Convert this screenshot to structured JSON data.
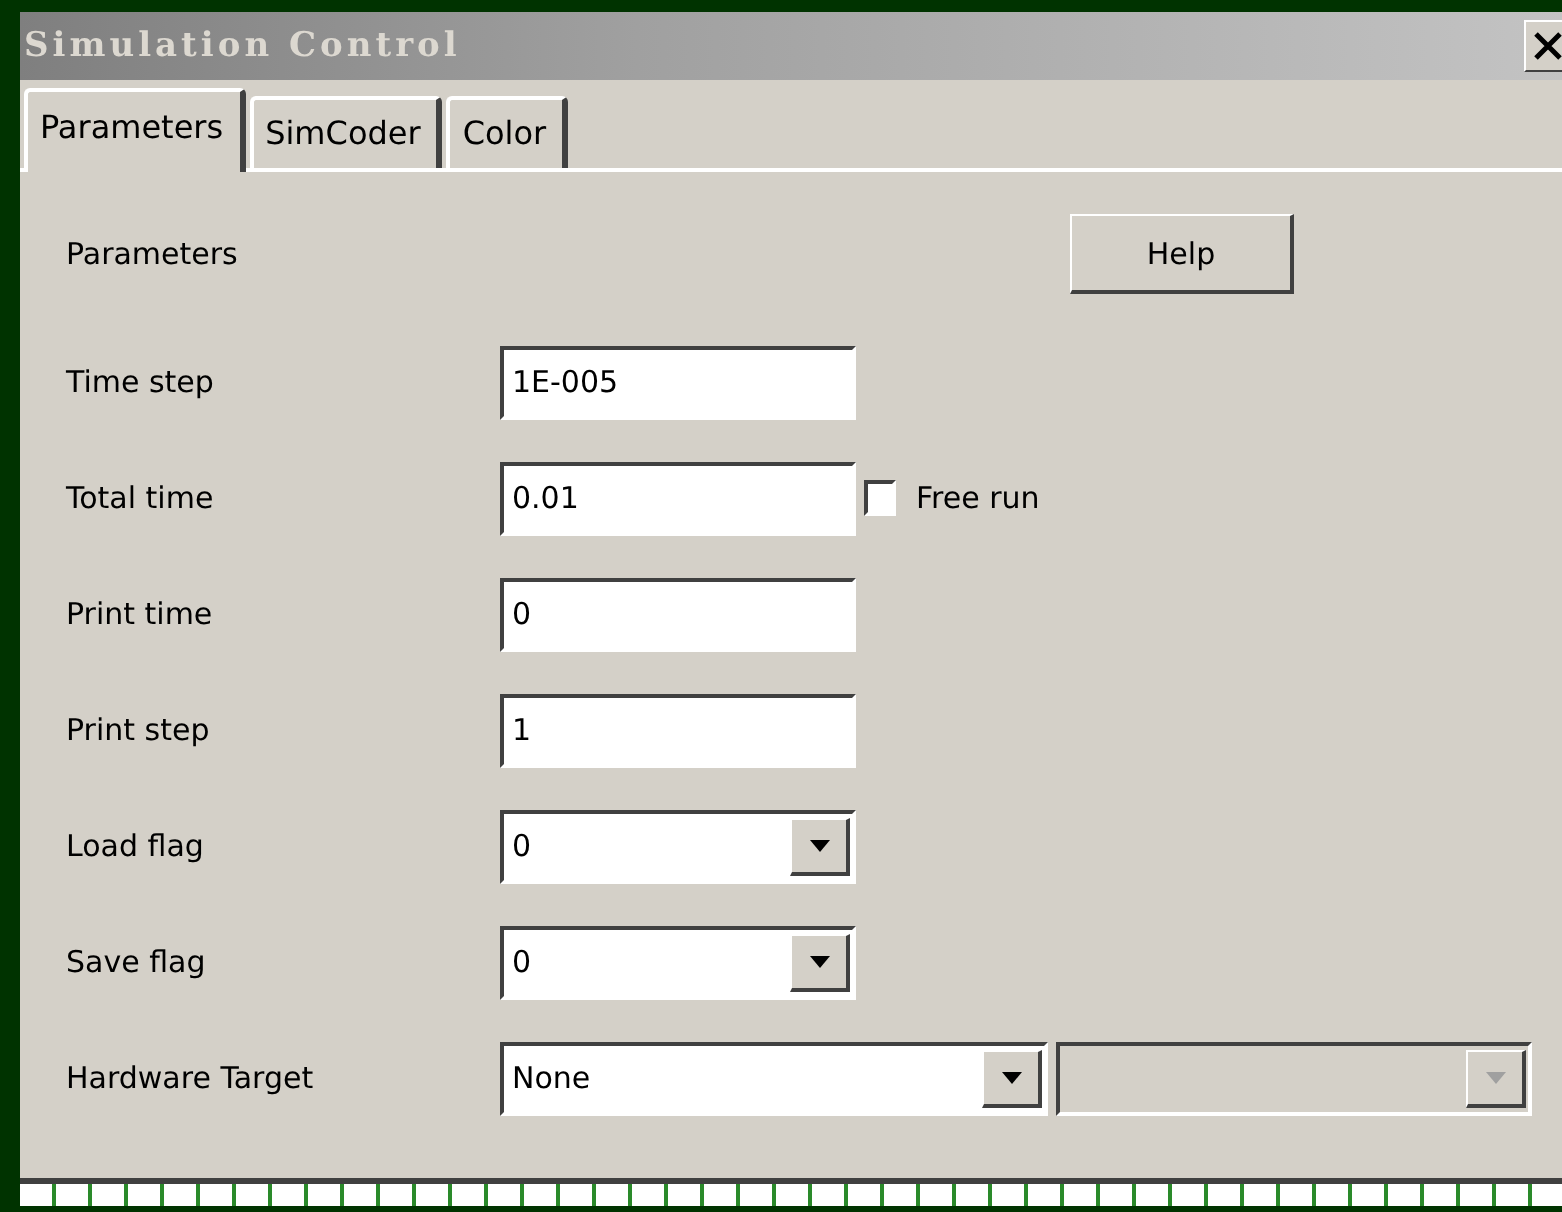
{
  "window": {
    "title": "Simulation Control"
  },
  "tabs": [
    {
      "label": "Parameters",
      "selected": true
    },
    {
      "label": "SimCoder",
      "selected": false
    },
    {
      "label": "Color",
      "selected": false
    }
  ],
  "section_label": "Parameters",
  "help_button": "Help",
  "fields": [
    {
      "kind": "text",
      "label": "Time step",
      "value": "1E-005"
    },
    {
      "kind": "text",
      "label": "Total time",
      "value": "0.01",
      "checkbox": {
        "label": "Free run",
        "checked": false
      }
    },
    {
      "kind": "text",
      "label": "Print time",
      "value": "0"
    },
    {
      "kind": "text",
      "label": "Print step",
      "value": "1"
    },
    {
      "kind": "dropdown",
      "label": "Load flag",
      "value": "0"
    },
    {
      "kind": "dropdown",
      "label": "Save flag",
      "value": "0"
    },
    {
      "kind": "dropdown_pair",
      "label": "Hardware Target",
      "value": "None",
      "second_disabled": true
    }
  ]
}
